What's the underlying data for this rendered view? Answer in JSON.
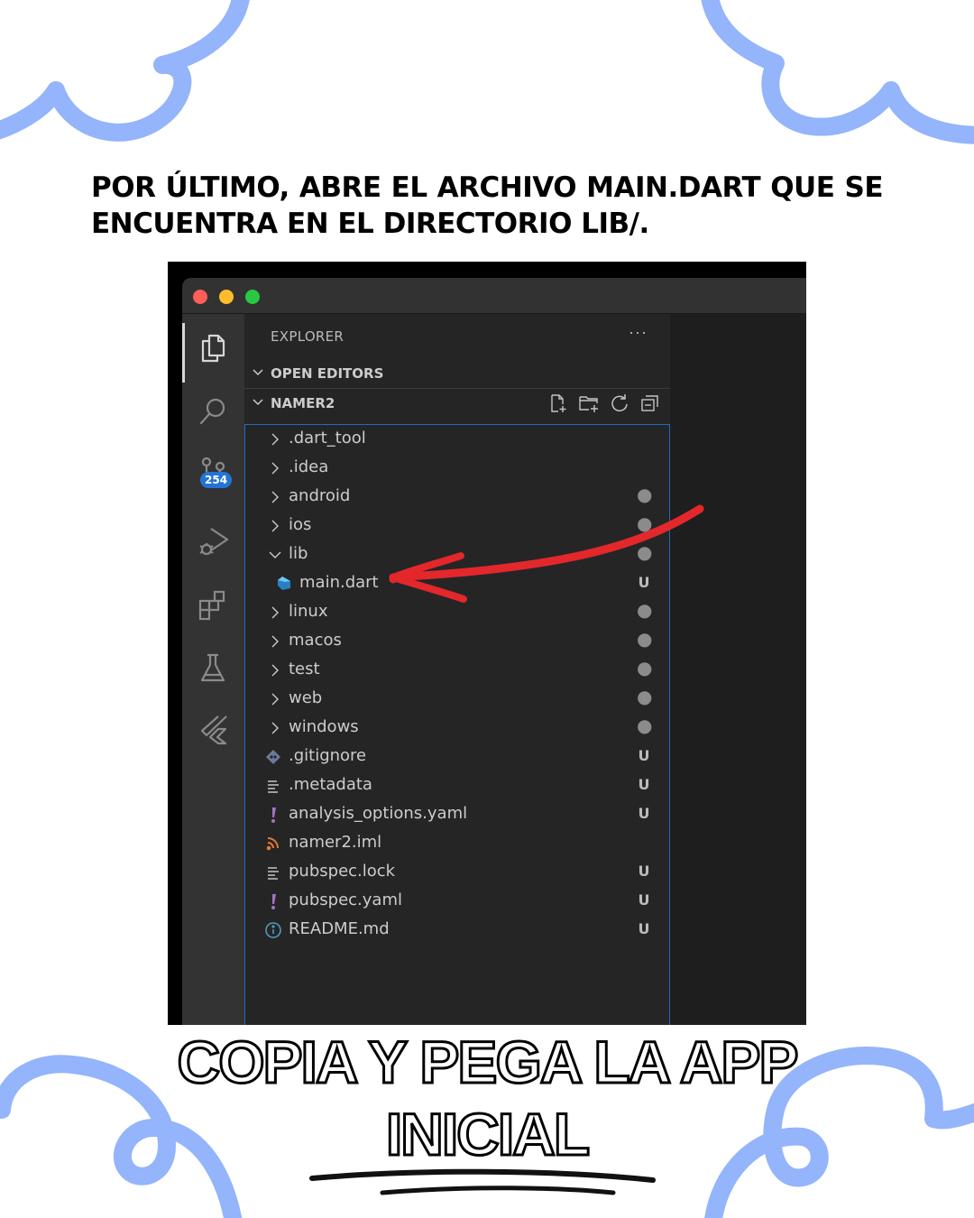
{
  "heading": {
    "line1": "POR ÚLTIMO, ABRE EL ARCHIVO MAIN.DART QUE SE",
    "line2": "ENCUENTRA EN EL DIRECTORIO LIB/."
  },
  "vscode": {
    "explorer_title": "EXPLORER",
    "more_actions": "···",
    "open_editors_label": "OPEN EDITORS",
    "project_label": "NAMER2",
    "source_control_badge": "254",
    "activity_icons": [
      "files-icon",
      "search-icon",
      "source-control-icon",
      "run-debug-icon",
      "extensions-icon",
      "testing-icon",
      "flutter-icon"
    ],
    "toolbar_icons": [
      "new-file-icon",
      "new-folder-icon",
      "refresh-icon",
      "collapse-all-icon"
    ],
    "tree": [
      {
        "name": ".dart_tool",
        "kind": "folder",
        "status": ""
      },
      {
        "name": ".idea",
        "kind": "folder",
        "status": ""
      },
      {
        "name": "android",
        "kind": "folder",
        "status": "●"
      },
      {
        "name": "ios",
        "kind": "folder",
        "status": "●"
      },
      {
        "name": "lib",
        "kind": "folder-open",
        "status": "●"
      },
      {
        "name": "main.dart",
        "kind": "dart-file",
        "status": "U"
      },
      {
        "name": "linux",
        "kind": "folder",
        "status": "●"
      },
      {
        "name": "macos",
        "kind": "folder",
        "status": "●"
      },
      {
        "name": "test",
        "kind": "folder",
        "status": "●"
      },
      {
        "name": "web",
        "kind": "folder",
        "status": "●"
      },
      {
        "name": "windows",
        "kind": "folder",
        "status": "●"
      },
      {
        "name": ".gitignore",
        "kind": "git-file",
        "status": "U"
      },
      {
        "name": ".metadata",
        "kind": "text-file",
        "status": "U"
      },
      {
        "name": "analysis_options.yaml",
        "kind": "yaml-file",
        "status": "U"
      },
      {
        "name": "namer2.iml",
        "kind": "rss-file",
        "status": ""
      },
      {
        "name": "pubspec.lock",
        "kind": "text-file",
        "status": "U"
      },
      {
        "name": "pubspec.yaml",
        "kind": "yaml-file",
        "status": "U"
      },
      {
        "name": "README.md",
        "kind": "info-file",
        "status": "U"
      }
    ]
  },
  "bottom_title": {
    "line1": "COPIA Y PEGA LA APP",
    "line2": "INICIAL"
  },
  "colors": {
    "decoration": "#94b4fb",
    "arrow": "#e3272b",
    "badge": "#2374d6",
    "focus_border": "#1d6bbd"
  }
}
